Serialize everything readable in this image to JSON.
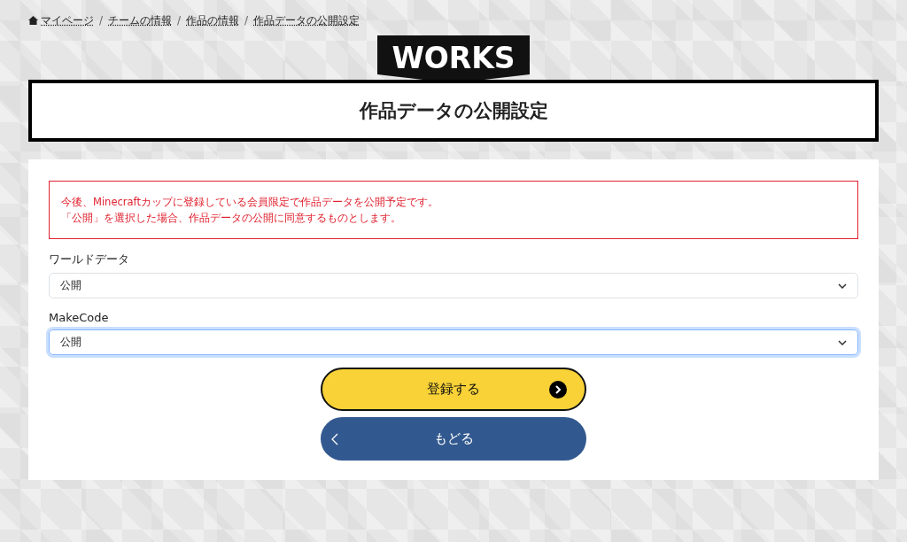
{
  "breadcrumb": [
    {
      "label": "マイページ",
      "home": true
    },
    {
      "label": "チームの情報",
      "home": false
    },
    {
      "label": "作品の情報",
      "home": false
    },
    {
      "label": "作品データの公開設定",
      "home": false
    }
  ],
  "separator": "/",
  "logo": "WORKS",
  "title": "作品データの公開設定",
  "notice": [
    "今後、Minecraftカップに登録している会員限定で作品データを公開予定です。",
    "「公開」を選択した場合、作品データの公開に同意するものとします。"
  ],
  "fields": [
    {
      "label": "ワールドデータ",
      "value": "公開",
      "focused": false
    },
    {
      "label": "MakeCode",
      "value": "公開",
      "focused": true
    }
  ],
  "buttons": [
    {
      "label": "登録する",
      "kind": "primary"
    },
    {
      "label": "もどる",
      "kind": "back"
    }
  ]
}
